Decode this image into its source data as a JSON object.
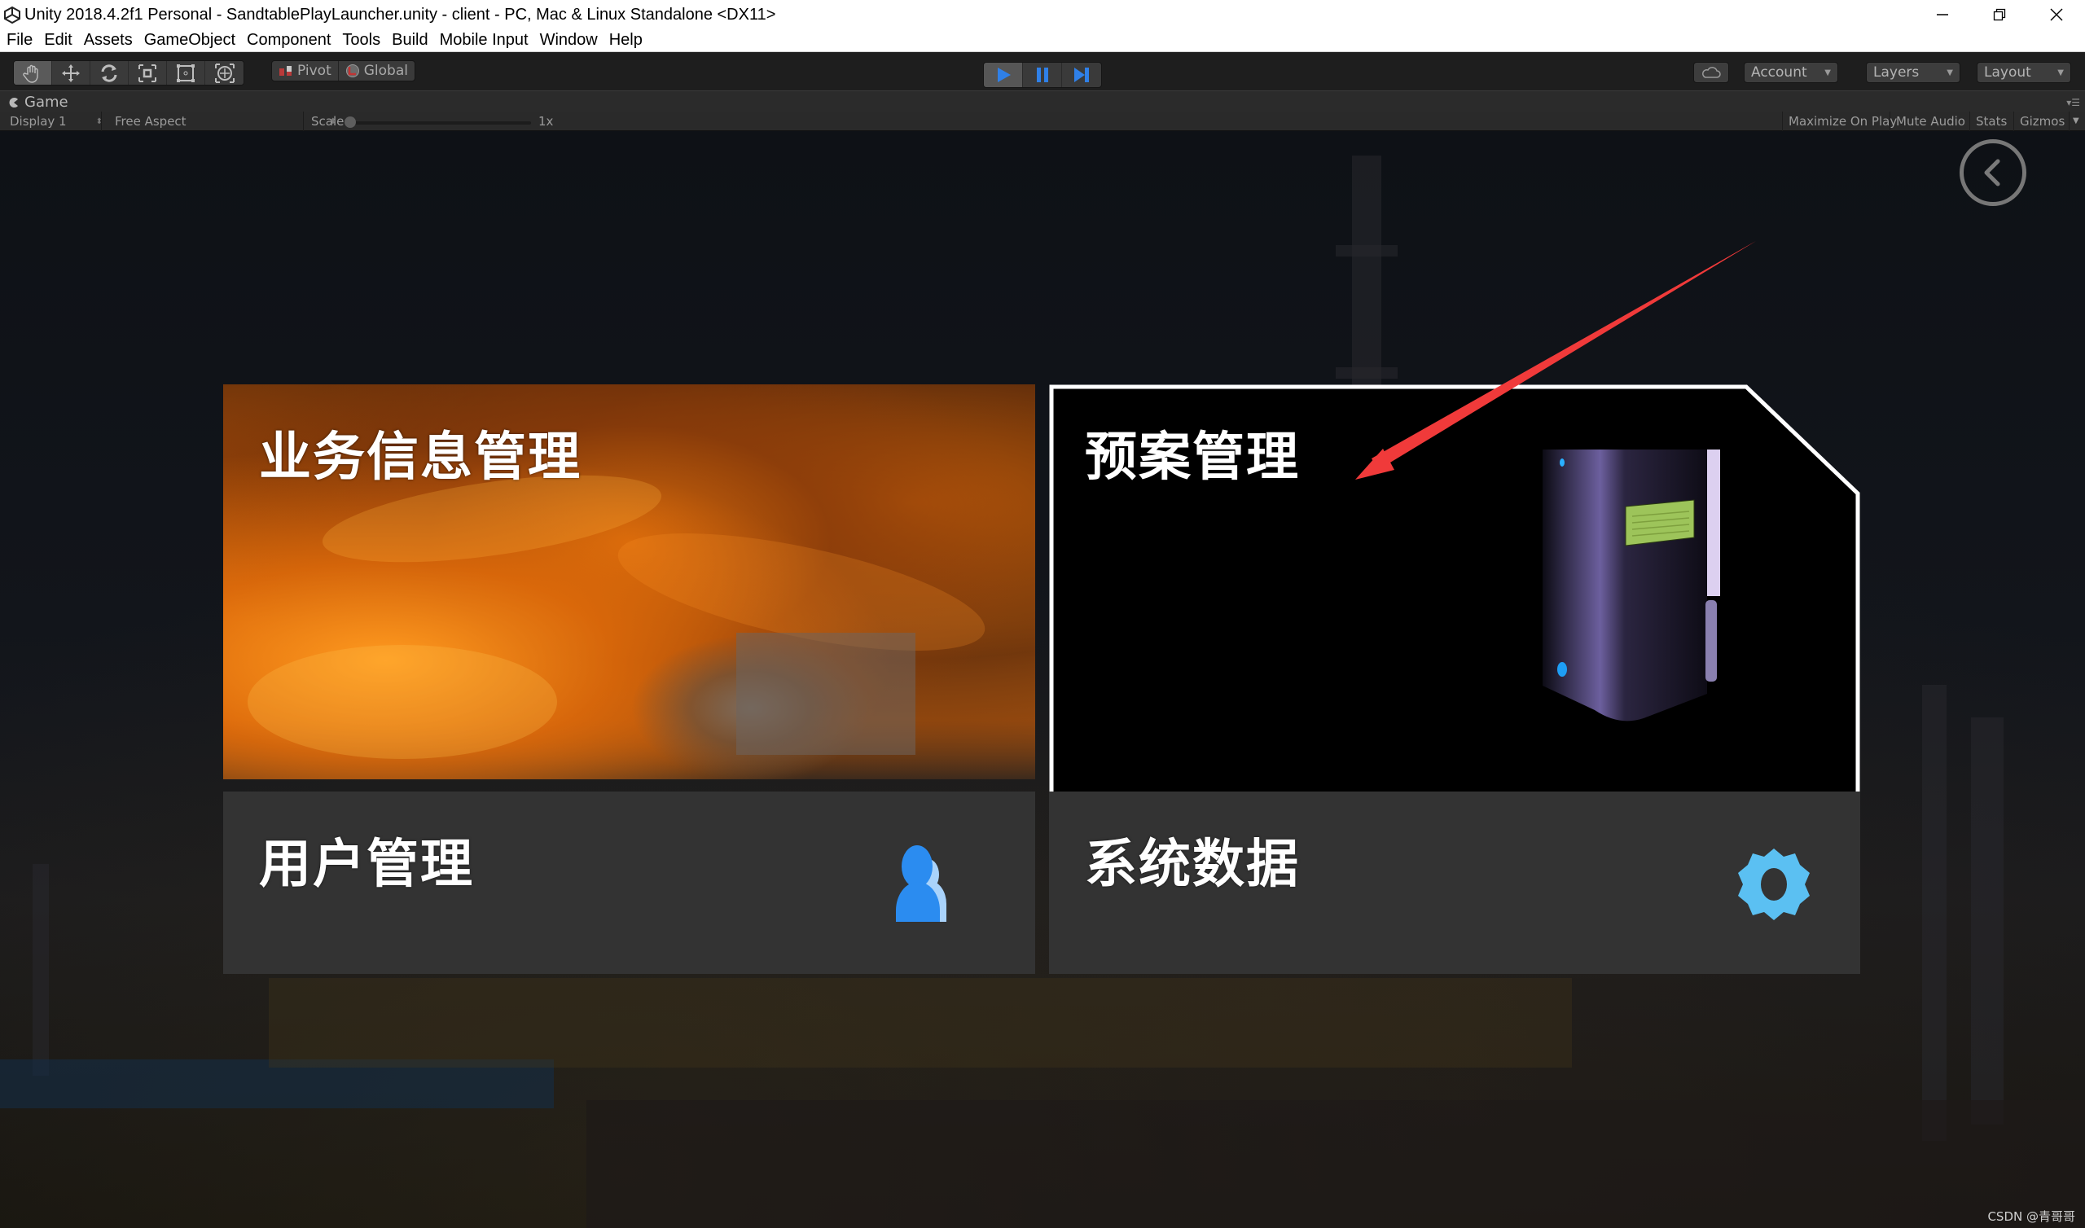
{
  "window": {
    "title": "Unity 2018.4.2f1 Personal - SandtablePlayLauncher.unity - client - PC, Mac & Linux Standalone <DX11>",
    "controls": [
      "minimize-icon",
      "restore-icon",
      "close-icon"
    ]
  },
  "menubar": {
    "items": [
      "File",
      "Edit",
      "Assets",
      "GameObject",
      "Component",
      "Tools",
      "Build",
      "Mobile Input",
      "Window",
      "Help"
    ]
  },
  "toolbar": {
    "tools": [
      "hand-tool-icon",
      "move-tool-icon",
      "rotate-tool-icon",
      "scale-tool-icon",
      "rect-tool-icon",
      "transform-tool-icon"
    ],
    "active_tool": "hand-tool-icon",
    "pivot_label": "Pivot",
    "global_label": "Global",
    "play_state": "playing",
    "account_label": "Account",
    "layers_label": "Layers",
    "layout_label": "Layout"
  },
  "game_view": {
    "tab_label": "Game",
    "display": "Display 1",
    "aspect": "Free Aspect",
    "scale_label": "Scale",
    "scale_value": "1x",
    "buttons": [
      "Maximize On Play",
      "Mute Audio",
      "Stats",
      "Gizmos"
    ]
  },
  "launcher": {
    "tiles": [
      {
        "id": "business",
        "title": "业务信息管理"
      },
      {
        "id": "plan",
        "title": "预案管理",
        "selected": true
      },
      {
        "id": "user",
        "title": "用户管理"
      },
      {
        "id": "sysdata",
        "title": "系统数据"
      }
    ],
    "colors": {
      "tile_bg": "#333333",
      "user_icon": "#2b8cf0",
      "user_icon_light": "#a9d3fb",
      "gear_icon": "#5bc0f2",
      "selection_border": "#ffffff",
      "annotation_arrow": "#f03a3a"
    }
  },
  "watermark": "CSDN @青哥哥"
}
